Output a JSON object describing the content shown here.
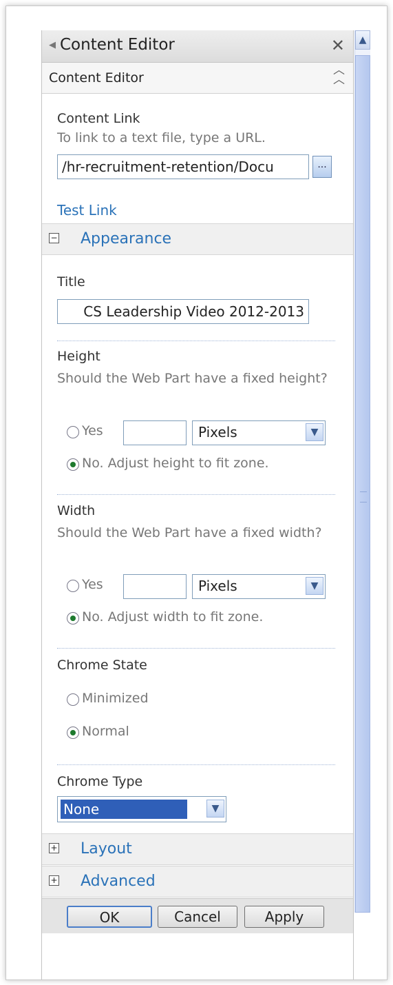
{
  "panel": {
    "title": "Content Editor",
    "section_title": "Content Editor"
  },
  "content_link": {
    "label": "Content Link",
    "hint": "To link to a text file, type a URL.",
    "value": "/hr-recruitment-retention/Docu",
    "browse_label": "...",
    "test_link": "Test Link"
  },
  "appearance": {
    "header": "Appearance",
    "toggle": "−",
    "title_label": "Title",
    "title_value": "CS Leadership Video 2012-2013",
    "height_label": "Height",
    "height_hint": "Should the Web Part have a fixed height?",
    "height_yes": "Yes",
    "height_unit": "Pixels",
    "height_no": "No. Adjust height to fit zone.",
    "width_label": "Width",
    "width_hint": "Should the Web Part have a fixed width?",
    "width_yes": "Yes",
    "width_unit": "Pixels",
    "width_no": "No. Adjust width to fit zone.",
    "chrome_state_label": "Chrome State",
    "chrome_minimized": "Minimized",
    "chrome_normal": "Normal",
    "chrome_type_label": "Chrome Type",
    "chrome_type_value": "None"
  },
  "layout": {
    "header": "Layout",
    "toggle": "+"
  },
  "advanced": {
    "header": "Advanced",
    "toggle": "+"
  },
  "footer": {
    "ok": "OK",
    "cancel": "Cancel",
    "apply": "Apply"
  },
  "icons": {
    "back": "triangle-left-icon",
    "close": "close-icon",
    "collapse": "double-chevron-up-icon",
    "dropdown": "chevron-down-icon",
    "scroll_up": "chevron-up-icon"
  }
}
